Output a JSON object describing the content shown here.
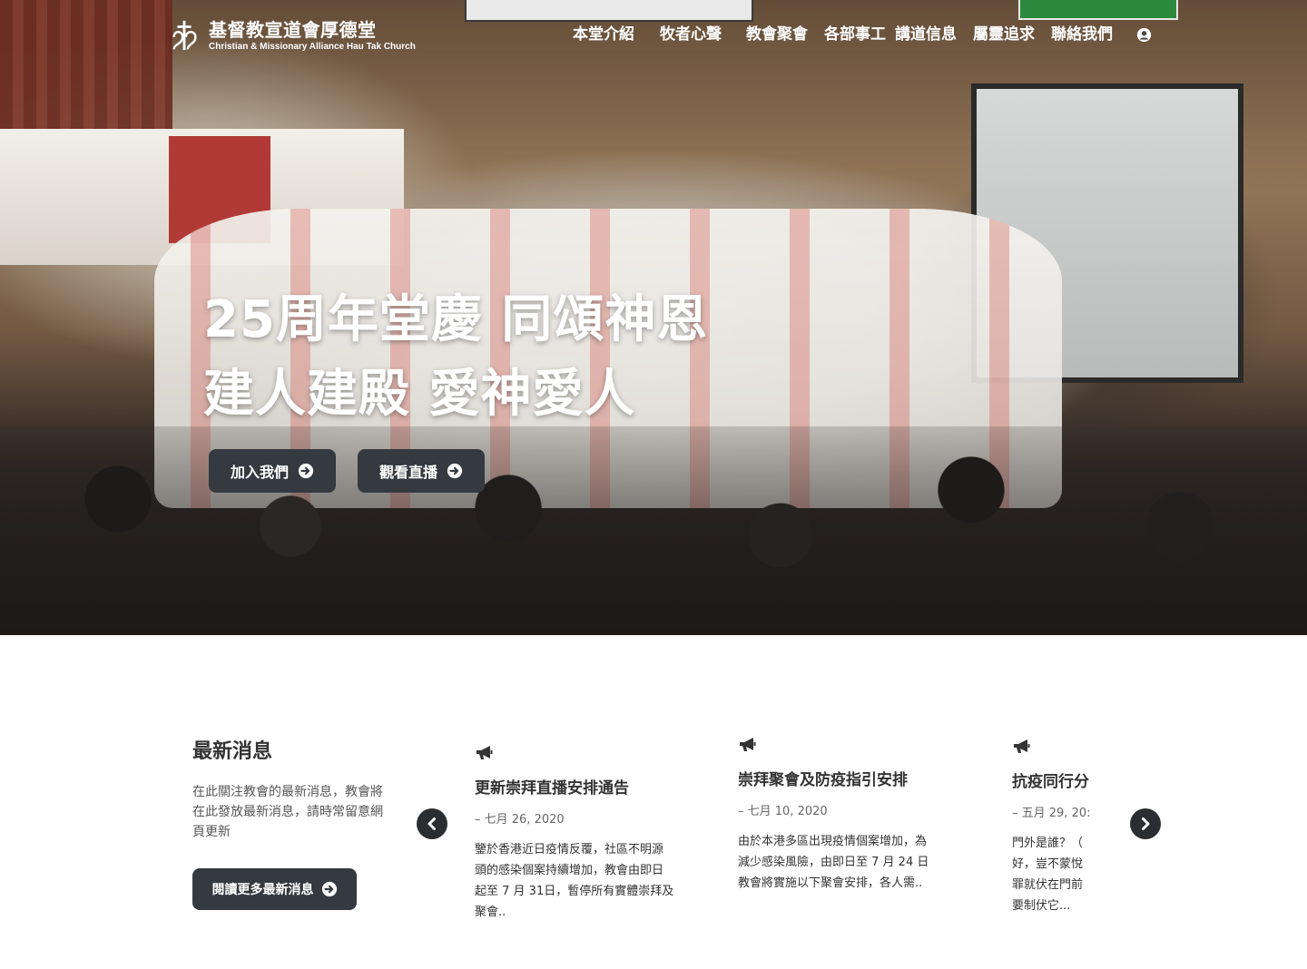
{
  "site": {
    "name_zh": "基督教宣道會厚德堂",
    "name_en": "Christian & Missionary Alliance Hau Tak Church"
  },
  "nav": {
    "items": [
      {
        "label": "本堂介紹"
      },
      {
        "label": "牧者心聲"
      },
      {
        "label": "教會聚會"
      },
      {
        "label": "各部事工"
      },
      {
        "label": "講道信息"
      },
      {
        "label": "屬靈追求"
      },
      {
        "label": "聯絡我們"
      }
    ],
    "account_icon": "user-circle-icon"
  },
  "hero": {
    "line1": "25周年堂慶 同頌神恩",
    "line2": "建人建殿 愛神愛人",
    "buttons": {
      "join": "加入我們",
      "live": "觀看直播"
    },
    "button_icon": "arrow-circle-right-icon"
  },
  "news": {
    "heading": "最新消息",
    "description": "在此關注教會的最新消息，教會將在此發放最新消息，請時常留意網頁更新",
    "more_label": "閱讀更多最新消息",
    "item_icon": "megaphone-icon",
    "items": [
      {
        "title": "更新崇拜直播安排通告",
        "date": "– 七月 26, 2020",
        "excerpt": "鑒於香港近日疫情反覆，社區不明源頭的感染個案持續增加，教會由即日起至 7 月 31日，暫停所有實體崇拜及聚會.."
      },
      {
        "title": "崇拜聚會及防疫指引安排",
        "date": "– 七月 10, 2020",
        "excerpt": "由於本港多區出現疫情個案增加，為減少感染風險，由即日至 7 月 24 日教會將實施以下聚會安排，各人需.."
      },
      {
        "title": "抗疫同行分",
        "date": "– 五月 29, 20:",
        "excerpt": "門外是誰？（\n好，豈不蒙悅\n罪就伏在門前\n要制伏它..."
      }
    ],
    "prev_icon": "chevron-left-icon",
    "next_icon": "chevron-right-icon"
  },
  "colors": {
    "button_bg": "#343a40",
    "text_dark": "#333333",
    "white": "#ffffff"
  }
}
